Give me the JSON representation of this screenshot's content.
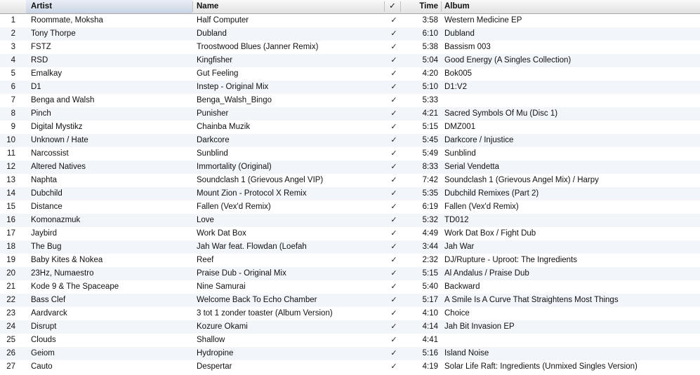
{
  "columns": {
    "artist": "Artist",
    "name": "Name",
    "check": "✓",
    "time": "Time",
    "album": "Album"
  },
  "sort": {
    "column": "artist",
    "direction": "ascending",
    "icon": "sort-up-arrow-icon"
  },
  "rows": [
    {
      "num": "1",
      "artist": "Roommate, Moksha",
      "name": "Half Computer",
      "checked": "✓",
      "time": "3:58",
      "album": "Western Medicine EP"
    },
    {
      "num": "2",
      "artist": "Tony Thorpe",
      "name": "Dubland",
      "checked": "✓",
      "time": "6:10",
      "album": "Dubland"
    },
    {
      "num": "3",
      "artist": "FSTZ",
      "name": "Troostwood Blues (Janner Remix)",
      "checked": "✓",
      "time": "5:38",
      "album": "Bassism 003"
    },
    {
      "num": "4",
      "artist": "RSD",
      "name": "Kingfisher",
      "checked": "✓",
      "time": "5:04",
      "album": "Good Energy (A Singles Collection)"
    },
    {
      "num": "5",
      "artist": "Emalkay",
      "name": "Gut Feeling",
      "checked": "✓",
      "time": "4:20",
      "album": "Bok005"
    },
    {
      "num": "6",
      "artist": "D1",
      "name": "Instep - Original Mix",
      "checked": "✓",
      "time": "5:10",
      "album": "D1:V2"
    },
    {
      "num": "7",
      "artist": "Benga and Walsh",
      "name": "Benga_Walsh_Bingo",
      "checked": "✓",
      "time": "5:33",
      "album": ""
    },
    {
      "num": "8",
      "artist": "Pinch",
      "name": "Punisher",
      "checked": "✓",
      "time": "4:21",
      "album": "Sacred Symbols Of Mu (Disc 1)"
    },
    {
      "num": "9",
      "artist": "Digital Mystikz",
      "name": "Chainba Muzik",
      "checked": "✓",
      "time": "5:15",
      "album": "DMZ001"
    },
    {
      "num": "10",
      "artist": "Unknown / Hate",
      "name": "Darkcore",
      "checked": "✓",
      "time": "5:45",
      "album": "Darkcore / Injustice"
    },
    {
      "num": "11",
      "artist": "Narcossist",
      "name": "Sunblind",
      "checked": "✓",
      "time": "5:49",
      "album": "Sunblind"
    },
    {
      "num": "12",
      "artist": "Altered Natives",
      "name": "Immortality (Original)",
      "checked": "✓",
      "time": "8:33",
      "album": "Serial Vendetta"
    },
    {
      "num": "13",
      "artist": "Naphta",
      "name": "Soundclash 1 (Grievous Angel VIP)",
      "checked": "✓",
      "time": "7:42",
      "album": "Soundclash 1 (Grievous Angel Mix) / Harpy"
    },
    {
      "num": "14",
      "artist": "Dubchild",
      "name": "Mount Zion - Protocol X Remix",
      "checked": "✓",
      "time": "5:35",
      "album": "Dubchild Remixes (Part 2)"
    },
    {
      "num": "15",
      "artist": "Distance",
      "name": "Fallen (Vex'd Remix)",
      "checked": "✓",
      "time": "6:19",
      "album": "Fallen (Vex'd Remix)"
    },
    {
      "num": "16",
      "artist": "Komonazmuk",
      "name": "Love",
      "checked": "✓",
      "time": "5:32",
      "album": "TD012"
    },
    {
      "num": "17",
      "artist": "Jaybird",
      "name": "Work Dat Box",
      "checked": "✓",
      "time": "4:49",
      "album": "Work Dat Box / Fight Dub"
    },
    {
      "num": "18",
      "artist": "The Bug",
      "name": "Jah War feat. Flowdan (Loefah",
      "checked": "✓",
      "time": "3:44",
      "album": "Jah War"
    },
    {
      "num": "19",
      "artist": "Baby Kites & Nokea",
      "name": "Reef",
      "checked": "✓",
      "time": "2:32",
      "album": "DJ/Rupture - Uproot: The Ingredients"
    },
    {
      "num": "20",
      "artist": "23Hz, Numaestro",
      "name": "Praise Dub - Original Mix",
      "checked": "✓",
      "time": "5:15",
      "album": "Al Andalus / Praise Dub"
    },
    {
      "num": "21",
      "artist": "Kode 9 & The Spaceape",
      "name": "Nine Samurai",
      "checked": "✓",
      "time": "5:40",
      "album": "Backward"
    },
    {
      "num": "22",
      "artist": "Bass Clef",
      "name": "Welcome Back To Echo Chamber",
      "checked": "✓",
      "time": "5:17",
      "album": "A Smile Is A Curve That Straightens Most Things"
    },
    {
      "num": "23",
      "artist": "Aardvarck",
      "name": "3 tot 1 zonder toaster (Album Version)",
      "checked": "✓",
      "time": "4:10",
      "album": "Choice"
    },
    {
      "num": "24",
      "artist": "Disrupt",
      "name": "Kozure Okami",
      "checked": "✓",
      "time": "4:14",
      "album": "Jah Bit Invasion EP"
    },
    {
      "num": "25",
      "artist": "Clouds",
      "name": "Shallow",
      "checked": "✓",
      "time": "4:41",
      "album": ""
    },
    {
      "num": "26",
      "artist": "Geiom",
      "name": "Hydropine",
      "checked": "✓",
      "time": "5:16",
      "album": "Island Noise"
    },
    {
      "num": "27",
      "artist": "Cauto",
      "name": "Despertar",
      "checked": "✓",
      "time": "4:19",
      "album": "Solar Life Raft: Ingredients (Unmixed Singles Version)"
    }
  ]
}
